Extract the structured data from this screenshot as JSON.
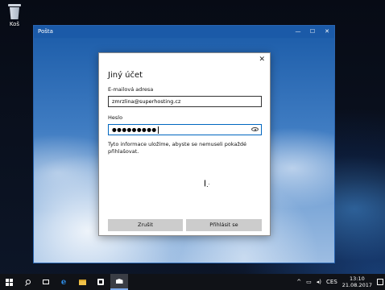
{
  "desktop": {
    "recycle_bin_label": "Koš"
  },
  "window": {
    "title": "Pošta",
    "controls": {
      "minimize": "—",
      "maximize": "☐",
      "close": "✕"
    }
  },
  "dialog": {
    "close_glyph": "✕",
    "title": "Jiný účet",
    "email_label": "E-mailová adresa",
    "email_value": "zmrzlina@superhosting.cz",
    "password_label": "Heslo",
    "password_value": "●●●●●●●●●",
    "info_text": "Tyto informace uložíme, abyste se nemuseli pokaždé přihlašovat.",
    "cancel_label": "Zrušit",
    "signin_label": "Přihlásit se"
  },
  "taskbar": {
    "icons": [
      "windows-start-icon",
      "search-icon",
      "task-view-icon",
      "edge-icon",
      "file-explorer-icon",
      "store-icon",
      "mail-icon"
    ],
    "active_app": "mail-icon",
    "tray": {
      "chevron": "^",
      "network": "▭",
      "volume": "◂)",
      "language": "CES"
    },
    "time": "13:10",
    "date": "21.08.2017"
  }
}
